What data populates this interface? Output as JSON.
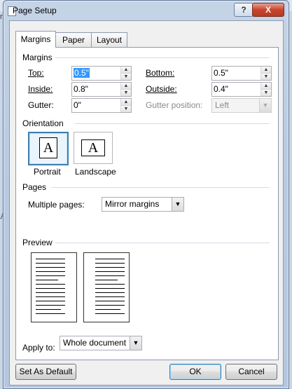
{
  "window": {
    "title": "Page Setup",
    "help_label": "?",
    "close_label": "X"
  },
  "tabs": [
    {
      "label": "Margins"
    },
    {
      "label": "Paper"
    },
    {
      "label": "Layout"
    }
  ],
  "margins_section": {
    "title": "Margins",
    "top": {
      "label": "Top:",
      "value": "0.5\""
    },
    "bottom": {
      "label": "Bottom:",
      "value": "0.5\""
    },
    "inside": {
      "label": "Inside:",
      "value": "0.8\""
    },
    "outside": {
      "label": "Outside:",
      "value": "0.4\""
    },
    "gutter": {
      "label": "Gutter:",
      "value": "0\""
    },
    "gutter_position": {
      "label": "Gutter position:",
      "value": "Left",
      "disabled": true
    }
  },
  "orientation": {
    "title": "Orientation",
    "portrait": {
      "label": "Portrait",
      "glyph": "A",
      "selected": true
    },
    "landscape": {
      "label": "Landscape",
      "glyph": "A",
      "selected": false
    }
  },
  "pages": {
    "title": "Pages",
    "multiple_pages_label": "Multiple pages:",
    "multiple_pages_value": "Mirror margins"
  },
  "preview": {
    "title": "Preview"
  },
  "apply_to": {
    "label": "Apply to:",
    "value": "Whole document"
  },
  "buttons": {
    "set_default": "Set As Default",
    "ok": "OK",
    "cancel": "Cancel"
  },
  "background_fragments": {
    "left_top": "rr",
    "left_mid": "A"
  },
  "colors": {
    "selected_border": "#3c7fb1",
    "selection_highlight": "#3399ff",
    "close_red": "#c8442c"
  }
}
